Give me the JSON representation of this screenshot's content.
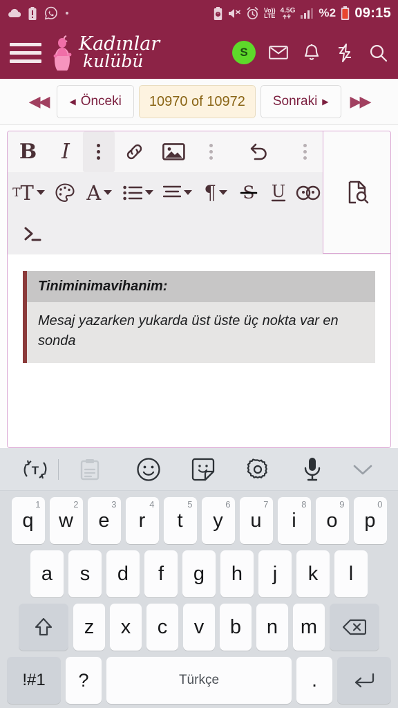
{
  "statusbar": {
    "left_icons": [
      "cloud-icon",
      "battery-alert-icon",
      "whatsapp-icon",
      "dot-icon"
    ],
    "right": {
      "battery_saver_icon": "battery-saver-icon",
      "mute_icon": "mute-icon",
      "alarm_icon": "alarm-icon",
      "volte_top": "Vo))",
      "volte_bottom": "LTE",
      "network_label": "4.5G",
      "signal_icon": "signal-bars-icon",
      "battery_percent": "%2",
      "battery_icon": "battery-low-icon",
      "time": "09:15"
    }
  },
  "header": {
    "menu_icon": "hamburger-menu-icon",
    "brand_line1": "Kadınlar",
    "brand_line2": "kulübü",
    "brand_mark_icon": "woman-figure-logo-icon",
    "avatar_initial": "S",
    "avatar_color": "#5ED92A",
    "icons": [
      "mail-icon",
      "bell-icon",
      "lightning-icon",
      "search-icon"
    ],
    "background_color": "#8C2346"
  },
  "pagination": {
    "first_icon": "double-chevron-left-icon",
    "prev_label": "Önceki",
    "prev_caret": "◀",
    "count_label": "10970 of 10972",
    "next_label": "Sonraki",
    "next_caret": "▶",
    "last_icon": "double-chevron-right-icon",
    "count_bg": "#fdf3e0",
    "count_fg": "#8a6516"
  },
  "editor": {
    "border_color": "#dba8d4",
    "toolbar_row1": [
      {
        "name": "bold-button",
        "glyph": "B",
        "kind": "bold"
      },
      {
        "name": "italic-button",
        "glyph": "I",
        "kind": "italic"
      },
      {
        "name": "more-options-button",
        "glyph": "",
        "kind": "dots-active"
      },
      {
        "name": "link-button",
        "glyph": "",
        "kind": "link"
      },
      {
        "name": "image-button",
        "glyph": "",
        "kind": "image"
      },
      {
        "name": "more-options-2-button",
        "glyph": "",
        "kind": "dots-light"
      },
      {
        "name": "undo-button",
        "glyph": "",
        "kind": "undo"
      },
      {
        "name": "more-options-3-button",
        "glyph": "",
        "kind": "dots-light"
      }
    ],
    "preview_button": "document-preview-icon",
    "toolbar_row2": [
      {
        "name": "font-size-button",
        "kind": "fontsize",
        "caret": true
      },
      {
        "name": "color-palette-button",
        "kind": "palette",
        "caret": false
      },
      {
        "name": "text-color-button",
        "kind": "textcolor",
        "caret": true
      },
      {
        "name": "bullet-list-button",
        "kind": "list",
        "caret": true
      },
      {
        "name": "align-button",
        "kind": "align",
        "caret": true
      },
      {
        "name": "paragraph-button",
        "kind": "paragraph",
        "caret": true
      },
      {
        "name": "strikethrough-button",
        "kind": "strike",
        "caret": false
      },
      {
        "name": "underline-button",
        "kind": "underline",
        "caret": false
      },
      {
        "name": "smiley-button",
        "kind": "smiley",
        "caret": false
      }
    ],
    "toolbar_row3": [
      {
        "name": "code-button",
        "kind": "code",
        "caret": false
      }
    ],
    "quote": {
      "author": "Tiniminimavihanim:",
      "text": "Mesaj yazarken yukarda üst üste üç nokta var en sonda",
      "accent_color": "#8B3A3A",
      "head_bg": "#c7c6c6",
      "body_bg": "#e6e5e4"
    }
  },
  "keyboard": {
    "toolbar": [
      "translate-icon",
      "clipboard-icon",
      "emoji-icon",
      "sticker-icon",
      "settings-gear-icon",
      "microphone-icon",
      "collapse-chevron-icon"
    ],
    "row1": [
      {
        "key": "q",
        "num": "1"
      },
      {
        "key": "w",
        "num": "2"
      },
      {
        "key": "e",
        "num": "3"
      },
      {
        "key": "r",
        "num": "4"
      },
      {
        "key": "t",
        "num": "5"
      },
      {
        "key": "y",
        "num": "6"
      },
      {
        "key": "u",
        "num": "7"
      },
      {
        "key": "i",
        "num": "8"
      },
      {
        "key": "o",
        "num": "9"
      },
      {
        "key": "p",
        "num": "0"
      }
    ],
    "row2": [
      "a",
      "s",
      "d",
      "f",
      "g",
      "h",
      "j",
      "k",
      "l"
    ],
    "row3_shift": "shift-icon",
    "row3": [
      "z",
      "x",
      "c",
      "v",
      "b",
      "n",
      "m"
    ],
    "row3_delete": "backspace-icon",
    "row4": {
      "symbols": "!#1",
      "question": "?",
      "space": "Türkçe",
      "period": ".",
      "enter": "enter-icon"
    }
  }
}
